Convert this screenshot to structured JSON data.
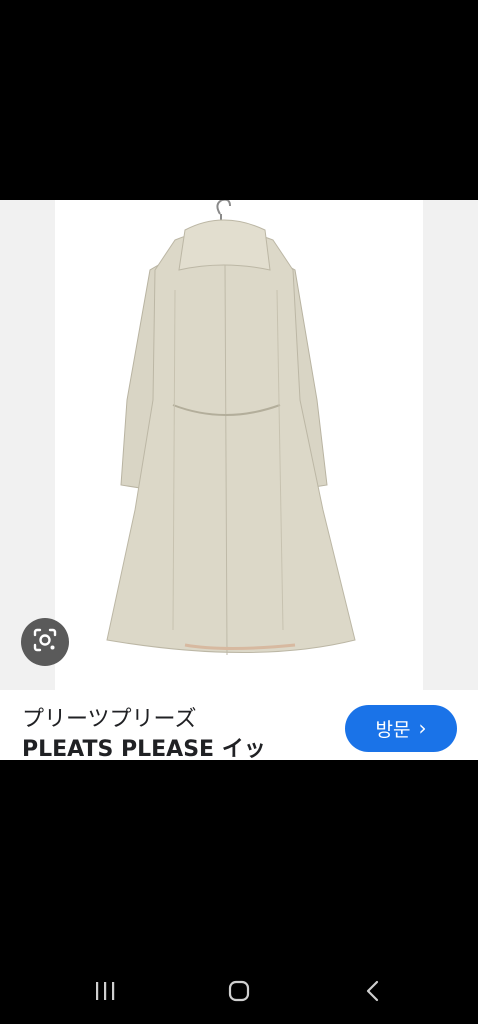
{
  "product": {
    "title_line1": "プリーツプリーズ",
    "title_line2": "PLEATS PLEASE イッ",
    "visit_label": "방문",
    "visit_chevron": "›",
    "image_subject": "beige long hooded coat on hanger (back view)"
  },
  "icons": {
    "lens": "google-lens-icon",
    "recents": "recent-apps-icon",
    "home": "home-icon",
    "back": "back-icon"
  },
  "colors": {
    "accent": "#1a73e8",
    "coat": "#d8d4c3",
    "background": "#000000"
  }
}
